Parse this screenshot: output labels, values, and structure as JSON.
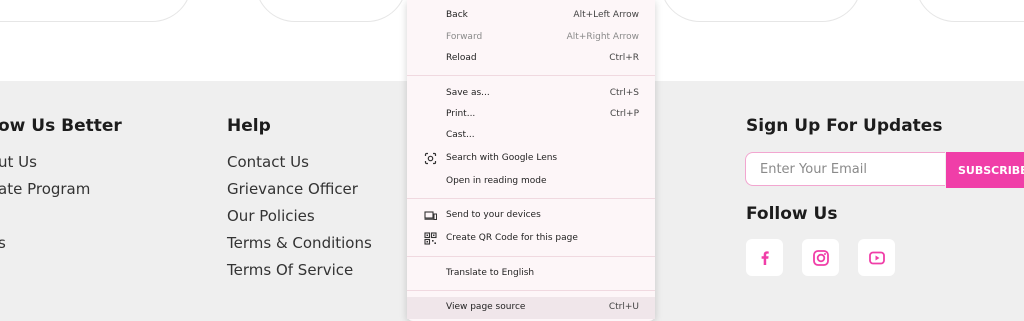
{
  "footer": {
    "col1": {
      "title": "ow Us Better",
      "links": [
        "ut Us",
        "ate Program",
        "",
        "s"
      ]
    },
    "col2": {
      "title": "Help",
      "links": [
        "Contact Us",
        "Grievance Officer",
        "Our Policies",
        "Terms & Conditions",
        "Terms Of Service"
      ]
    },
    "signup": {
      "title": "Sign Up For Updates",
      "email_placeholder": "Enter Your Email",
      "subscribe_label": "SUBSCRIBE"
    },
    "follow": {
      "title": "Follow Us",
      "icons": [
        "facebook-icon",
        "instagram-icon",
        "youtube-icon"
      ]
    }
  },
  "context_menu": {
    "items": [
      {
        "label": "Back",
        "shortcut": "Alt+Left Arrow"
      },
      {
        "label": "Forward",
        "shortcut": "Alt+Right Arrow"
      },
      {
        "label": "Reload",
        "shortcut": "Ctrl+R"
      },
      {
        "label": "Save as...",
        "shortcut": "Ctrl+S"
      },
      {
        "label": "Print...",
        "shortcut": "Ctrl+P"
      },
      {
        "label": "Cast...",
        "shortcut": ""
      },
      {
        "label": "Search with Google Lens",
        "shortcut": ""
      },
      {
        "label": "Open in reading mode",
        "shortcut": ""
      },
      {
        "label": "Send to your devices",
        "shortcut": ""
      },
      {
        "label": "Create QR Code for this page",
        "shortcut": ""
      },
      {
        "label": "Translate to English",
        "shortcut": ""
      },
      {
        "label": "View page source",
        "shortcut": "Ctrl+U"
      }
    ]
  },
  "colors": {
    "accent": "#f03ea8",
    "footer_bg": "#efefef",
    "menu_bg": "#fdf6f8"
  }
}
